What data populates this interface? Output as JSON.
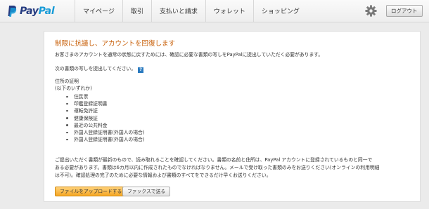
{
  "brand": {
    "pay": "Pay",
    "pal": "Pal"
  },
  "nav": {
    "items": [
      {
        "label": "マイページ"
      },
      {
        "label": "取引"
      },
      {
        "label": "支払いと請求"
      },
      {
        "label": "ウォレット"
      },
      {
        "label": "ショッピング"
      }
    ]
  },
  "header": {
    "settings_icon": "gear-icon",
    "logout_label": "ログアウト"
  },
  "main": {
    "title": "制限に抗議し、アカウントを回復します",
    "intro": "お客さまのアカウントを通常の状態に戻すためには、確認に必要な書類の写しをPayPalに提出していただく必要があります。",
    "instruction": "次の書類の写しを提出してください。",
    "help_icon": "?",
    "address_title": "住所の証明",
    "address_subtitle": "(以下のいずれか)",
    "documents": [
      "住民票",
      "印鑑登録証明書",
      "運転免許証",
      "健康保険証",
      "最近の公共料金",
      "外国人登録証明書(外国人の場合)",
      "外国人登録証明書(外国人の場合)"
    ],
    "note_lines": [
      "ご提出いただく書類が最新のもので、読み取れることを確認してください。書類の名前と住所は、PayPal アカウントに登録されているものと同一で",
      "ある必要があります。書類は6カ月以内に作成されたものでなければなりません。メールで受け取った書類のみをお送りください(オンラインの利用明細",
      "は不可)。確認処理の完了のために必要な情報および書類のすべてをできるだけ早くお送りください。"
    ],
    "upload_button": "ファイルをアップロードする",
    "fax_button": "ファックスで送る"
  },
  "colors": {
    "brand_dark": "#253b80",
    "brand_light": "#179bd7",
    "heading": "#c8600a",
    "primary_button": "#f5a623"
  }
}
